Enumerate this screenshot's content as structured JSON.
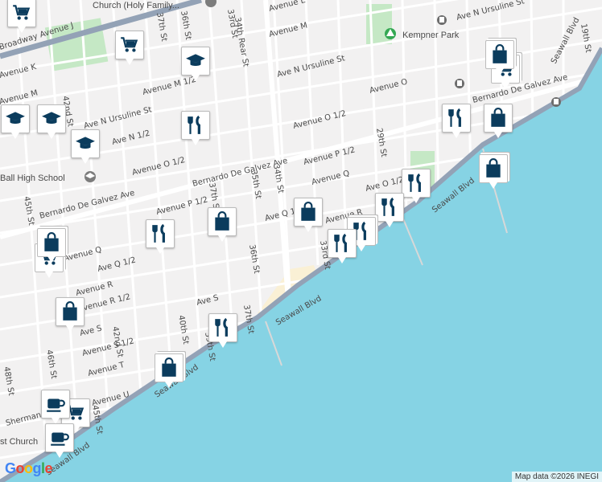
{
  "map": {
    "colors": {
      "land": "#f2f1f1",
      "water": "#86d3e4",
      "park": "#c5e8c5",
      "beach": "#faf0d5",
      "highway": "#93a2b6",
      "road": "#ffffff",
      "marker": "#0b3c5d"
    },
    "streets": {
      "broadway": "Broadway Avenue J",
      "seawall": "Seawall Blvd",
      "galvez": "Bernardo De Galvez Ave",
      "ave_o": "Avenue O",
      "ave_k": "Avenue K",
      "ave_l": "Avenue L",
      "ave_m": "Avenue M",
      "ave_m_half": "Avenue M 1/2",
      "ave_n_ursuline_top": "Ave N Ursuline St",
      "ave_n_ursuline_left": "Ave N Ursuline St",
      "ave_n_ursuline_right": "Ave N Ursuline St",
      "ave_n_half": "Ave N 1/2",
      "ave_o_half_left": "Avenue O 1/2",
      "ave_o_half_mid": "Avenue O 1/2",
      "ave_o_half_right": "Ave O 1/2",
      "ave_p_half_left": "Avenue P 1/2",
      "ave_p_half_right": "Avenue P 1/2",
      "ave_q": "Avenue Q",
      "ave_q_half_left": "Ave Q 1/2",
      "ave_q_half_mid": "Ave Q 1/2",
      "ave_q_left": "Avenue Q",
      "ave_r": "Avenue R",
      "ave_r_right": "Avenue R",
      "ave_r_half": "Avenue R 1/2",
      "ave_s": "Ave S",
      "ave_s_left": "Ave S",
      "ave_s_half": "Avenue S 1/2",
      "ave_t": "Avenue T",
      "ave_u": "Avenue U",
      "sherman": "Sherman",
      "ave_m_frag": "Avenue M",
      "ave_k_frag": "Avenue K",
      "st_33rd": "33rd St",
      "st_33rd_top": "33rd St",
      "st_34th": "34th St",
      "st_34th_rear": "34th Rear St",
      "st_35th": "35th St",
      "st_36th_top": "36th St",
      "st_36th": "36th St",
      "st_37th_top": "37th St",
      "st_37th": "37th St",
      "st_37th_low": "37th St",
      "st_37th_mid": "37th St",
      "st_39th": "39th St",
      "st_40th": "40th St",
      "st_42nd": "42nd St",
      "st_42nd_low": "42nd St",
      "st_45th": "45th St",
      "st_45th_low": "45th St",
      "st_46th": "46th St",
      "st_48th": "48th St",
      "st_29th": "29th St",
      "st_19th": "19th St"
    },
    "pois": {
      "church_holy_family": "Church (Holy Family...",
      "kempner_park": "Kempner Park",
      "ball_high_school": "Ball High School",
      "first_church": "st Church"
    },
    "markers": [
      {
        "name": "grocery-marker-1",
        "icon": "grocery-cart-icon"
      },
      {
        "name": "grocery-marker-2",
        "icon": "grocery-cart-icon"
      },
      {
        "name": "grocery-marker-3",
        "icon": "grocery-cart-icon"
      },
      {
        "name": "grocery-marker-4",
        "icon": "grocery-cart-icon"
      },
      {
        "name": "grocery-marker-5",
        "icon": "grocery-cart-icon"
      },
      {
        "name": "school-marker-1",
        "icon": "school-icon"
      },
      {
        "name": "school-marker-2",
        "icon": "school-icon"
      },
      {
        "name": "school-marker-3",
        "icon": "school-icon"
      },
      {
        "name": "school-marker-4",
        "icon": "school-icon"
      },
      {
        "name": "restaurant-marker-1",
        "icon": "restaurant-icon"
      },
      {
        "name": "restaurant-marker-2",
        "icon": "restaurant-icon"
      },
      {
        "name": "restaurant-marker-3",
        "icon": "restaurant-icon"
      },
      {
        "name": "restaurant-marker-4",
        "icon": "restaurant-icon"
      },
      {
        "name": "restaurant-marker-5",
        "icon": "restaurant-icon"
      },
      {
        "name": "restaurant-marker-6",
        "icon": "restaurant-icon"
      },
      {
        "name": "restaurant-marker-7",
        "icon": "restaurant-icon"
      },
      {
        "name": "restaurant-marker-8",
        "icon": "restaurant-icon"
      },
      {
        "name": "shopping-marker-1",
        "icon": "shopping-bag-icon"
      },
      {
        "name": "shopping-marker-2",
        "icon": "shopping-bag-icon"
      },
      {
        "name": "shopping-marker-3",
        "icon": "shopping-bag-icon"
      },
      {
        "name": "shopping-marker-4",
        "icon": "shopping-bag-icon"
      },
      {
        "name": "shopping-marker-5",
        "icon": "shopping-bag-icon"
      },
      {
        "name": "shopping-marker-6",
        "icon": "shopping-bag-icon"
      },
      {
        "name": "shopping-marker-7",
        "icon": "shopping-bag-icon"
      },
      {
        "name": "shopping-marker-8",
        "icon": "shopping-bag-icon"
      },
      {
        "name": "cafe-marker-1",
        "icon": "coffee-cup-icon"
      },
      {
        "name": "cafe-marker-2",
        "icon": "coffee-cup-icon"
      }
    ],
    "attribution": "Map data ©2026 INEGI",
    "logo": "Google"
  }
}
